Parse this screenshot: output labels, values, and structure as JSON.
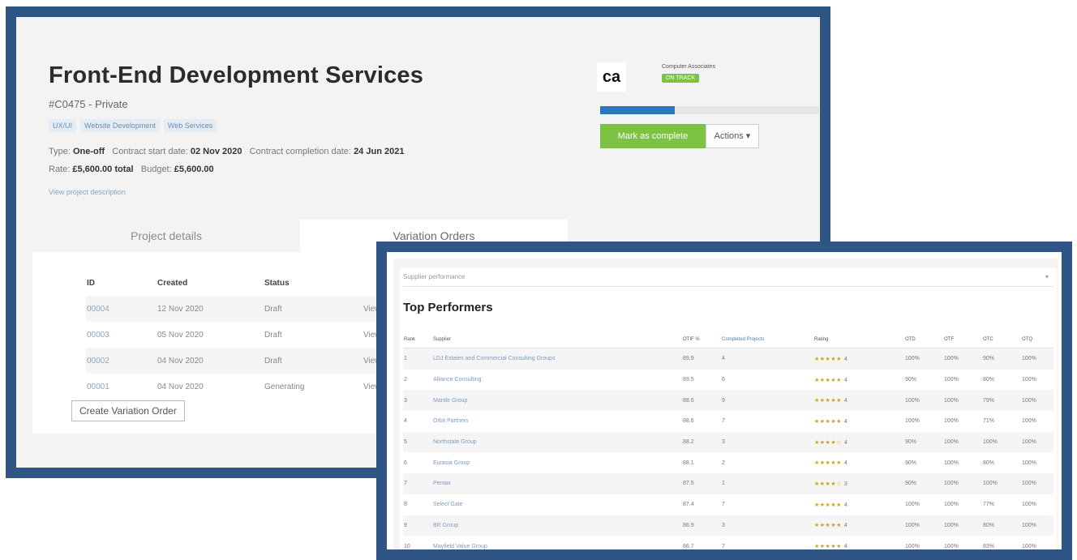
{
  "project": {
    "title": "Front-End Development Services",
    "code": "#C0475 - Private",
    "tags": [
      "UX/UI",
      "Website Development",
      "Web Services"
    ],
    "type_label": "Type:",
    "type_value": "One-off",
    "start_label": "Contract start date:",
    "start_value": "02 Nov 2020",
    "end_label": "Contract completion date:",
    "end_value": "24 Jun 2021",
    "rate_label": "Rate:",
    "rate_value": "£5,600.00 total",
    "budget_label": "Budget:",
    "budget_value": "£5,600.00",
    "description_link": "View project description"
  },
  "tabs": [
    "Project details",
    "Variation Orders"
  ],
  "variation_orders": {
    "headers": [
      "ID",
      "Created",
      "Status",
      ""
    ],
    "rows": [
      {
        "id": "00004",
        "created": "12 Nov 2020",
        "status": "Draft",
        "action": "View"
      },
      {
        "id": "00003",
        "created": "05 Nov 2020",
        "status": "Draft",
        "action": "View"
      },
      {
        "id": "00002",
        "created": "04 Nov 2020",
        "status": "Draft",
        "action": "View"
      },
      {
        "id": "00001",
        "created": "04 Nov 2020",
        "status": "Generating",
        "action": "View"
      }
    ],
    "create_button": "Create Variation Order"
  },
  "supplier_panel": {
    "logo_text": "ca",
    "company_name": "Computer Associates",
    "company_badge": "ON TRACK",
    "progress_fraction": 0.34,
    "mark_complete_button": "Mark as complete",
    "actions_button": "Actions ▾"
  },
  "top_performers": {
    "filter_placeholder": "Supplier performance",
    "title": "Top Performers",
    "headers": [
      "Rank",
      "Supplier",
      "OTIF %",
      "Completed Projects",
      "Rating",
      "OTD",
      "OTF",
      "OTC",
      "OTQ"
    ],
    "rows": [
      {
        "rank": "1",
        "supplier": "LDJ Estates and Commercial Consulting Groups",
        "score": "89.9",
        "projects": "4",
        "stars": "★★★★★",
        "rating": "4",
        "otd": "100%",
        "otf": "100%",
        "otc": "90%",
        "otq": "100%"
      },
      {
        "rank": "2",
        "supplier": "Alliance Consulting",
        "score": "89.5",
        "projects": "6",
        "stars": "★★★★★",
        "rating": "4",
        "otd": "90%",
        "otf": "100%",
        "otc": "80%",
        "otq": "100%"
      },
      {
        "rank": "3",
        "supplier": "Mantle Group",
        "score": "88.6",
        "projects": "9",
        "stars": "★★★★★",
        "rating": "4",
        "otd": "100%",
        "otf": "100%",
        "otc": "79%",
        "otq": "100%"
      },
      {
        "rank": "4",
        "supplier": "Orbit Partners",
        "score": "88.6",
        "projects": "7",
        "stars": "★★★★★",
        "rating": "4",
        "otd": "100%",
        "otf": "100%",
        "otc": "71%",
        "otq": "100%"
      },
      {
        "rank": "5",
        "supplier": "Northstate Group",
        "score": "88.2",
        "projects": "3",
        "stars": "★★★★☆",
        "rating": "4",
        "otd": "90%",
        "otf": "100%",
        "otc": "100%",
        "otq": "100%"
      },
      {
        "rank": "6",
        "supplier": "Eurasia Group",
        "score": "88.1",
        "projects": "2",
        "stars": "★★★★★",
        "rating": "4",
        "otd": "90%",
        "otf": "100%",
        "otc": "80%",
        "otq": "100%"
      },
      {
        "rank": "7",
        "supplier": "Pentax",
        "score": "87.5",
        "projects": "1",
        "stars": "★★★★☆",
        "rating": "3",
        "otd": "90%",
        "otf": "100%",
        "otc": "100%",
        "otq": "100%"
      },
      {
        "rank": "8",
        "supplier": "Select Gate",
        "score": "87.4",
        "projects": "7",
        "stars": "★★★★★",
        "rating": "4",
        "otd": "100%",
        "otf": "100%",
        "otc": "77%",
        "otq": "100%"
      },
      {
        "rank": "9",
        "supplier": "BR Group",
        "score": "86.9",
        "projects": "3",
        "stars": "★★★★★",
        "rating": "4",
        "otd": "100%",
        "otf": "100%",
        "otc": "80%",
        "otq": "100%"
      },
      {
        "rank": "10",
        "supplier": "Mayfield Value Group",
        "score": "86.7",
        "projects": "7",
        "stars": "★★★★★",
        "rating": "4",
        "otd": "100%",
        "otf": "100%",
        "otc": "83%",
        "otq": "100%"
      }
    ]
  }
}
